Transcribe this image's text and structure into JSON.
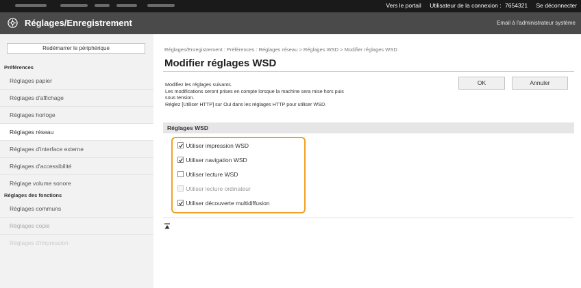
{
  "topbar": {
    "portal_link": "Vers le portail",
    "user_label": "Utilisateur de la connexion :",
    "user_id": "7654321",
    "logout_link": "Se déconnecter"
  },
  "header": {
    "title": "Réglages/Enregistrement",
    "admin_mail_link": "Email à l'administrateur système",
    "logo_icon": "gear-logo-icon"
  },
  "sidebar": {
    "restart_button": "Redémarrer le périphérique",
    "section_preferences": "Préférences",
    "preference_items": [
      "Réglages papier",
      "Réglages d'affichage",
      "Réglages horloge",
      "Réglages réseau",
      "Réglages d'interface externe",
      "Réglages d'accessibilité",
      "Réglage volume sonore"
    ],
    "active_item": "Réglages réseau",
    "section_functions": "Réglages des fonctions",
    "function_items": [
      "Réglages communs",
      "Réglages copie",
      "Réglages d'impression"
    ]
  },
  "main": {
    "breadcrumb": "Réglages/Enregistrement : Préférences : Réglages réseau > Réglages WSD > Modifier réglages WSD",
    "page_title": "Modifier réglages WSD",
    "description": [
      "Modifiez les réglages suivants.",
      "Les modifications seront prises en compte lorsque la machine sera mise hors puis",
      "sous tension.",
      "Réglez [Utiliser HTTP] sur Oui dans les réglages HTTP pour utiliser WSD."
    ],
    "ok_button": "OK",
    "cancel_button": "Annuler",
    "group_title": "Réglages WSD",
    "options": [
      {
        "label": "Utiliser impression WSD",
        "checked": true,
        "enabled": true
      },
      {
        "label": "Utiliser navigation WSD",
        "checked": true,
        "enabled": true
      },
      {
        "label": "Utiliser lecture WSD",
        "checked": false,
        "enabled": true
      },
      {
        "label": "Utiliser lecture ordinateur",
        "checked": false,
        "enabled": false
      },
      {
        "label": "Utiliser découverte multidiffusion",
        "checked": true,
        "enabled": true
      }
    ],
    "highlight_color": "#f0a022",
    "to_top_icon": "scroll-to-top-icon"
  }
}
